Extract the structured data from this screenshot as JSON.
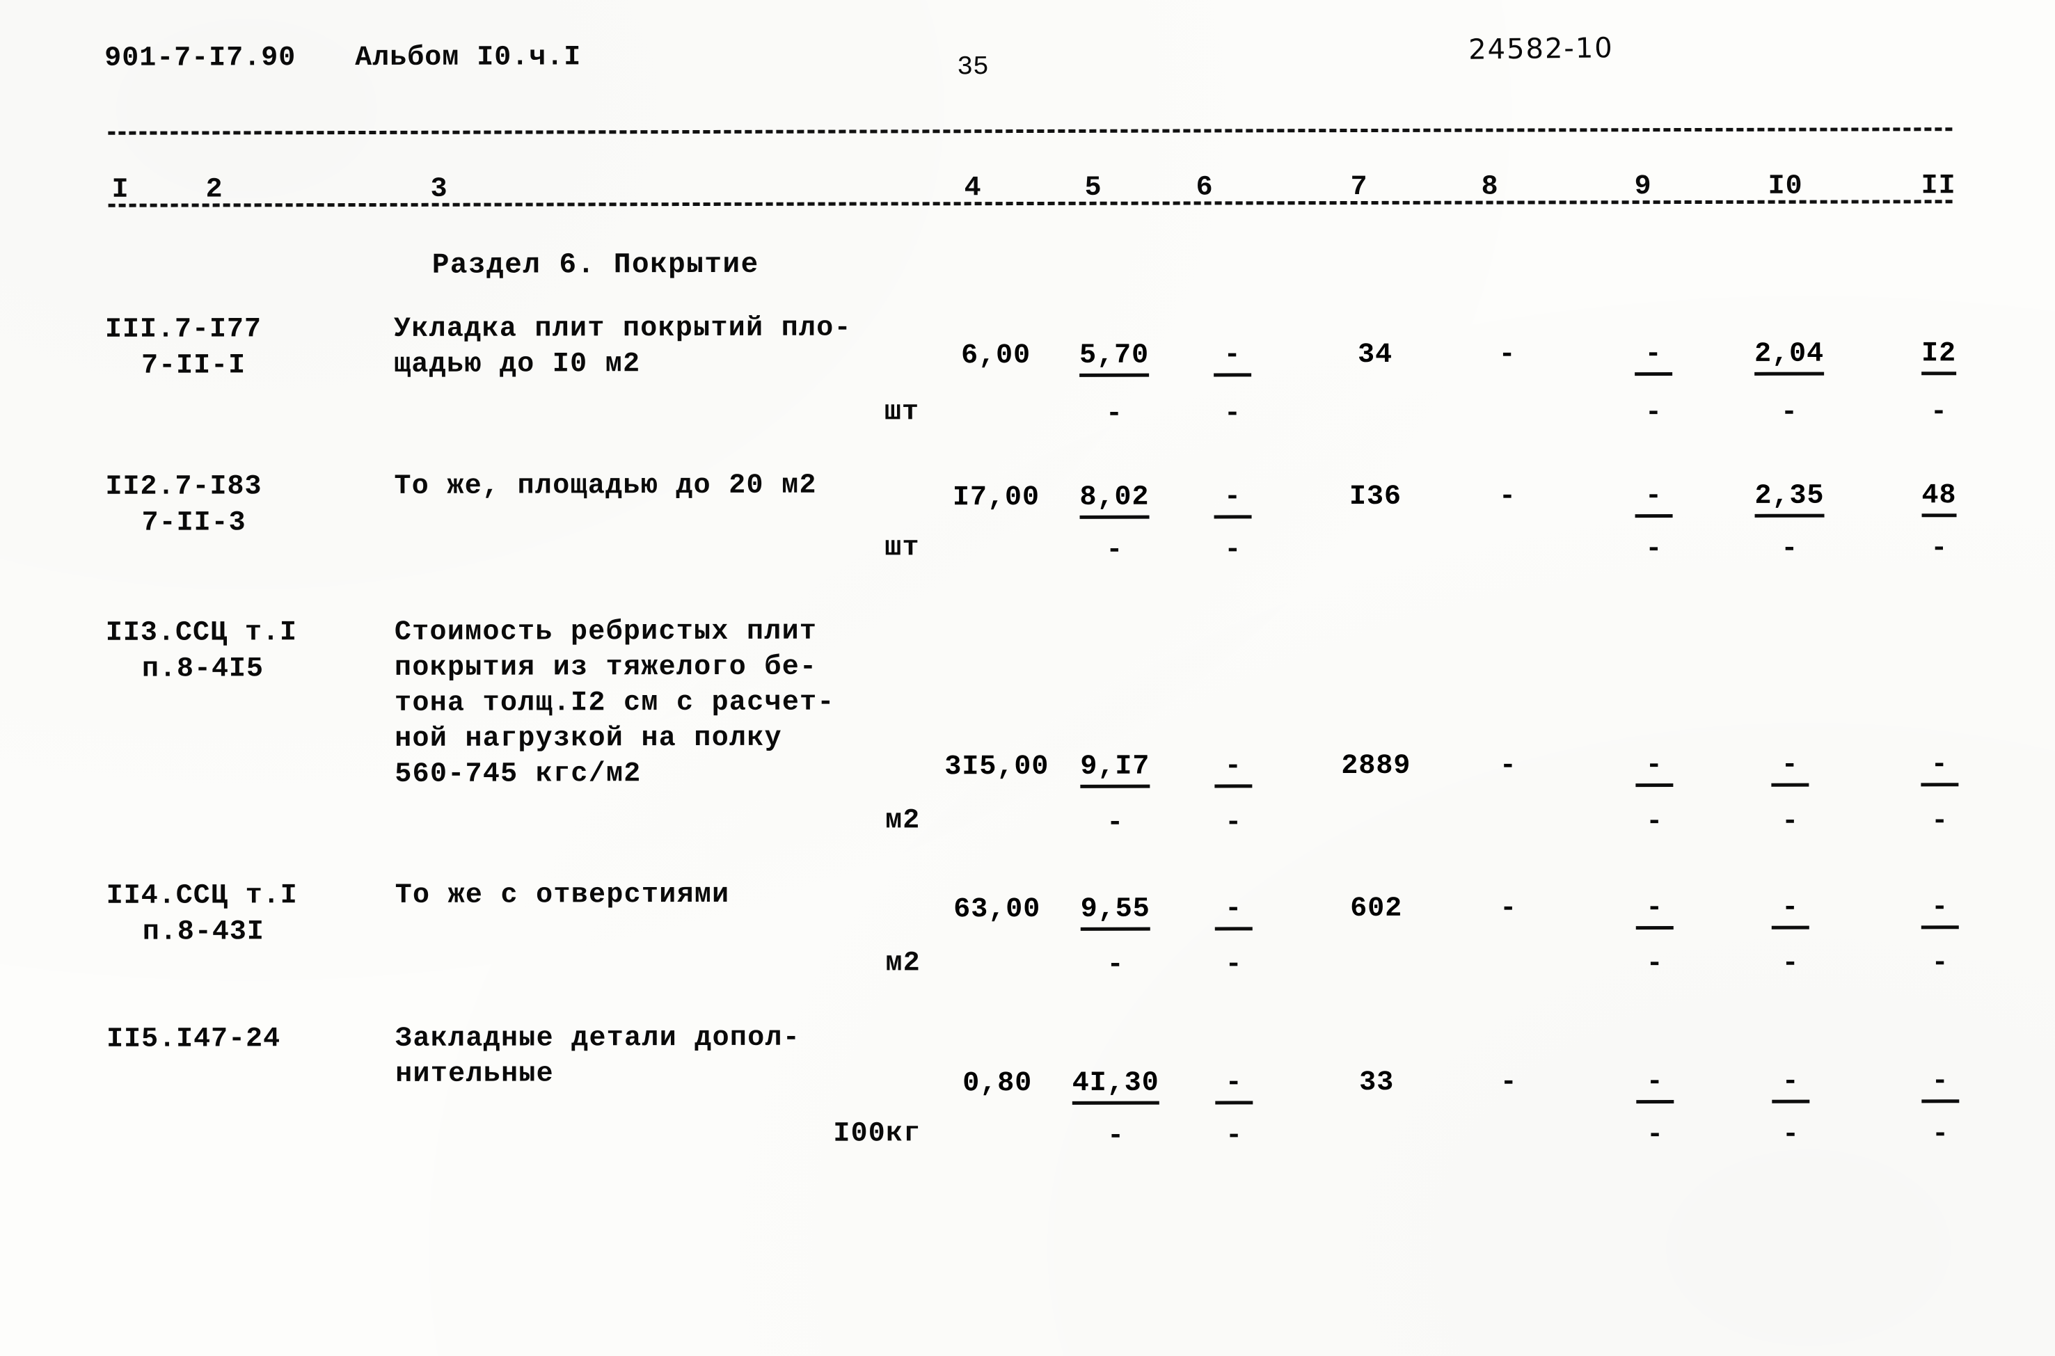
{
  "header": {
    "doc_code": "901-7-I7.90",
    "album_label": "Альбом I0.ч.I",
    "page_number": "35",
    "archive_code": "24582-10"
  },
  "table": {
    "column_numbers": [
      "I",
      "2",
      "3",
      "4",
      "5",
      "6",
      "7",
      "8",
      "9",
      "I0",
      "II"
    ],
    "section_title": "Раздел 6. Покрытие",
    "rows": [
      {
        "code_line1": "III.7-I77",
        "code_line2": "7-II-I",
        "desc_lines": [
          "Укладка плит покрытий пло-",
          "щадью до I0 м2"
        ],
        "unit": "шт",
        "c4": "6,00",
        "c5": "5,70",
        "c5_sub": "-",
        "c6": "-",
        "c6_sub": "-",
        "c7": "34",
        "c8": "-",
        "c9": "-",
        "c9_sub": "-",
        "c10": "2,04",
        "c10_sub": "-",
        "c11": "I2",
        "c11_sub": "-"
      },
      {
        "code_line1": "II2.7-I83",
        "code_line2": "7-II-3",
        "desc_lines": [
          "То же, площадью до 20 м2"
        ],
        "unit": "шт",
        "c4": "I7,00",
        "c5": "8,02",
        "c5_sub": "-",
        "c6": "-",
        "c6_sub": "-",
        "c7": "I36",
        "c8": "-",
        "c9": "-",
        "c9_sub": "-",
        "c10": "2,35",
        "c10_sub": "-",
        "c11": "48",
        "c11_sub": "-"
      },
      {
        "code_line1": "II3.ССЦ т.I",
        "code_line2": "п.8-4I5",
        "desc_lines": [
          "Стоимость ребристых плит",
          "покрытия из тяжелого бе-",
          "тона толщ.I2 см с расчет-",
          "ной нагрузкой на полку",
          "560-745 кгс/м2"
        ],
        "unit": "м2",
        "c4": "3I5,00",
        "c5": "9,I7",
        "c5_sub": "-",
        "c6": "-",
        "c6_sub": "-",
        "c7": "2889",
        "c8": "-",
        "c9": "-",
        "c9_sub": "-",
        "c10": "-",
        "c10_sub": "-",
        "c11": "-",
        "c11_sub": "-"
      },
      {
        "code_line1": "II4.ССЦ т.I",
        "code_line2": "п.8-43I",
        "desc_lines": [
          "То же с отверстиями"
        ],
        "unit": "м2",
        "c4": "63,00",
        "c5": "9,55",
        "c5_sub": "-",
        "c6": "-",
        "c6_sub": "-",
        "c7": "602",
        "c8": "-",
        "c9": "-",
        "c9_sub": "-",
        "c10": "-",
        "c10_sub": "-",
        "c11": "-",
        "c11_sub": "-"
      },
      {
        "code_line1": "II5.I47-24",
        "code_line2": "",
        "desc_lines": [
          "Закладные детали допол-",
          "нительные"
        ],
        "unit": "I00кг",
        "c4": "0,80",
        "c5": "4I,30",
        "c5_sub": "-",
        "c6": "-",
        "c6_sub": "-",
        "c7": "33",
        "c8": "-",
        "c9": "-",
        "c9_sub": "-",
        "c10": "-",
        "c10_sub": "-",
        "c11": "-",
        "c11_sub": "-"
      }
    ]
  }
}
